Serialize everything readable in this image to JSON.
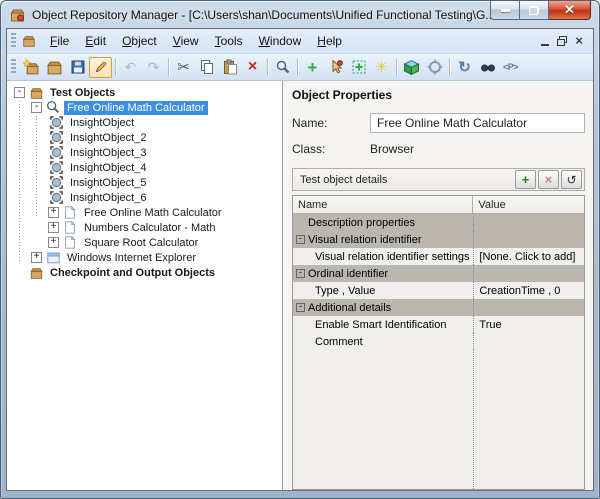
{
  "window": {
    "title": "Object Repository Manager - [C:\\Users\\shan\\Documents\\Unified Functional Testing\\G..."
  },
  "menu": {
    "items": [
      "File",
      "Edit",
      "Object",
      "View",
      "Tools",
      "Window",
      "Help"
    ]
  },
  "toolbar": {
    "icons": [
      "new-repository-icon",
      "open-repository-icon",
      "save-icon",
      "edit-pencil-icon",
      "undo-icon",
      "redo-icon",
      "cut-icon",
      "copy-icon",
      "paste-icon",
      "delete-icon",
      "find-icon",
      "add-objects-icon",
      "add-object-pointer-icon",
      "define-new-test-object-icon",
      "insight-object-icon",
      "object-cube-icon",
      "locate-icon",
      "update-from-application-icon",
      "spy-icon",
      "parameter-icon"
    ],
    "glyphs": {
      "undo": "↶",
      "redo": "↷",
      "cut": "✂",
      "delete": "×",
      "add": "+",
      "insight": "✳",
      "update": "↻",
      "parameter": "<P>"
    }
  },
  "tree": {
    "items": [
      {
        "label": "Test Objects",
        "icon": "repository-folder-icon",
        "expander": "-",
        "level": 0,
        "bold": true
      },
      {
        "label": "Free Online Math Calculator",
        "icon": "browser-icon",
        "expander": "-",
        "level": 1,
        "selected": true
      },
      {
        "label": "InsightObject",
        "icon": "insight-object-icon",
        "expander": "",
        "level": 2
      },
      {
        "label": "InsightObject_2",
        "icon": "insight-object-icon",
        "expander": "",
        "level": 2
      },
      {
        "label": "InsightObject_3",
        "icon": "insight-object-icon",
        "expander": "",
        "level": 2
      },
      {
        "label": "InsightObject_4",
        "icon": "insight-object-icon",
        "expander": "",
        "level": 2
      },
      {
        "label": "InsightObject_5",
        "icon": "insight-object-icon",
        "expander": "",
        "level": 2
      },
      {
        "label": "InsightObject_6",
        "icon": "insight-object-icon",
        "expander": "",
        "level": 2
      },
      {
        "label": "Free Online Math Calculator",
        "icon": "page-icon",
        "expander": "+",
        "level": 2
      },
      {
        "label": "Numbers Calculator - Math",
        "icon": "page-icon",
        "expander": "+",
        "level": 2
      },
      {
        "label": "Square Root Calculator",
        "icon": "page-icon",
        "expander": "+",
        "level": 2
      },
      {
        "label": "Windows Internet Explorer",
        "icon": "window-icon",
        "expander": "+",
        "level": 1
      },
      {
        "label": "Checkpoint and Output Objects",
        "icon": "repository-folder-icon",
        "expander": "",
        "level": 0,
        "bold": true
      }
    ]
  },
  "properties": {
    "header": "Object Properties",
    "name_label": "Name:",
    "name_value": "Free Online Math Calculator",
    "class_label": "Class:",
    "class_value": "Browser",
    "details": {
      "title": "Test object details",
      "buttons": [
        "add-icon",
        "delete-icon",
        "restore-icon"
      ],
      "columns": [
        "Name",
        "Value"
      ],
      "rows": [
        {
          "name": "Description properties",
          "value": "",
          "type": "group",
          "expander": ""
        },
        {
          "name": "Visual relation identifier",
          "value": "",
          "type": "group",
          "expander": "-"
        },
        {
          "name": "Visual relation identifier settings",
          "value": "[None. Click to add]",
          "type": "item"
        },
        {
          "name": "Ordinal identifier",
          "value": "",
          "type": "group",
          "expander": "-"
        },
        {
          "name": "Type , Value",
          "value": "CreationTime , 0",
          "type": "item"
        },
        {
          "name": "Additional details",
          "value": "",
          "type": "group",
          "expander": "-"
        },
        {
          "name": "Enable Smart Identification",
          "value": "True",
          "type": "item"
        },
        {
          "name": "Comment",
          "value": "",
          "type": "item"
        }
      ]
    }
  },
  "colors": {
    "selection": "#3d8ee2",
    "group_row": "#bcb7ae",
    "item_row": "#f0efec",
    "close_button": "#c03315",
    "active_tool_border": "#e09a35",
    "menubar": "#d6e4f5"
  }
}
